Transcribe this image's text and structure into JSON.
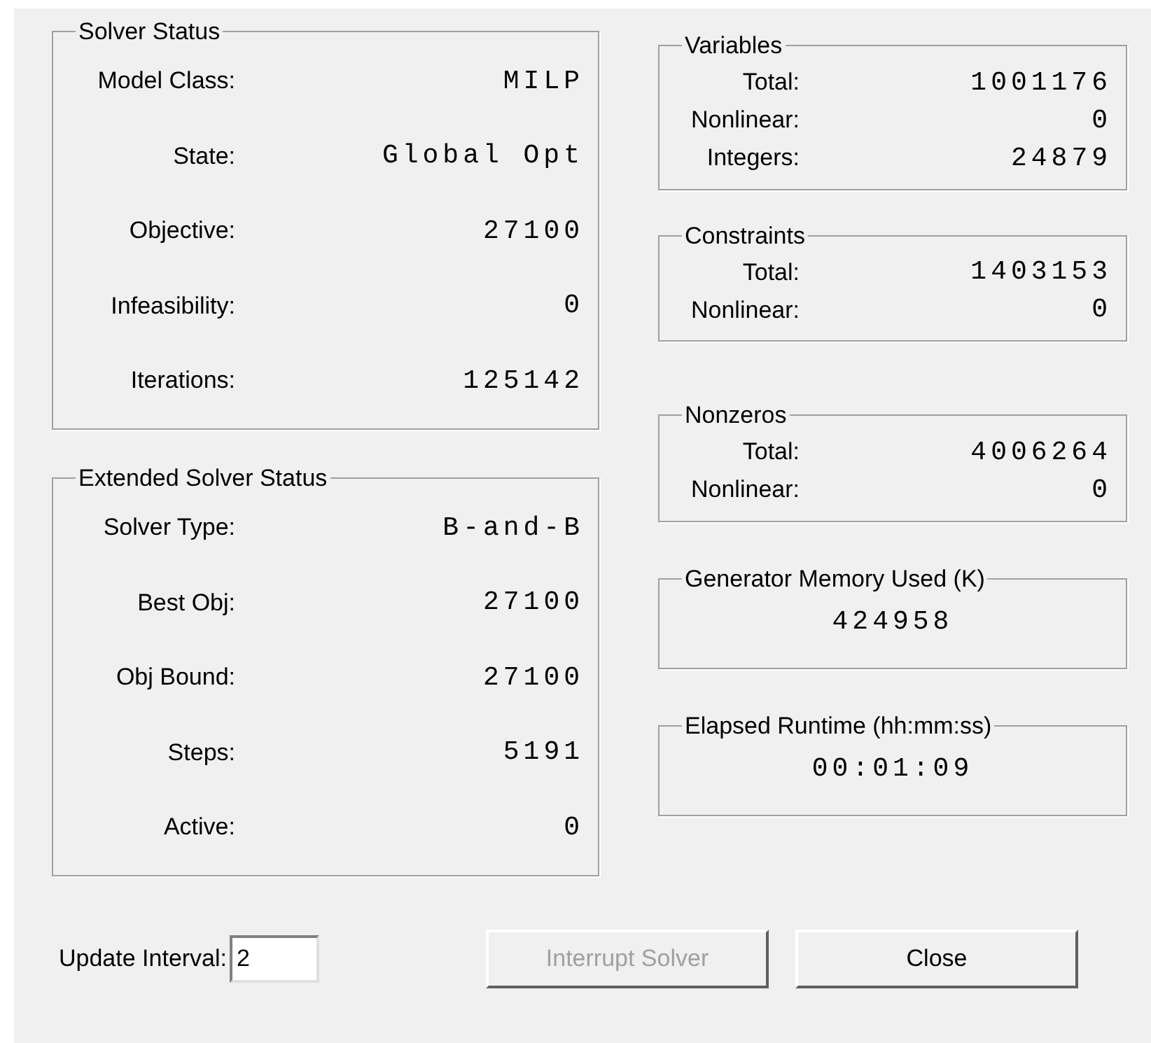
{
  "left_groups": [
    {
      "title": "Solver Status",
      "rows": [
        {
          "label": "Model Class:",
          "value": "MILP"
        },
        {
          "label": "State:",
          "value": "Global Opt"
        },
        {
          "label": "Objective:",
          "value": "27100"
        },
        {
          "label": "Infeasibility:",
          "value": "0"
        },
        {
          "label": "Iterations:",
          "value": "125142"
        }
      ]
    },
    {
      "title": "Extended Solver Status",
      "rows": [
        {
          "label": "Solver Type:",
          "value": "B-and-B"
        },
        {
          "label": "Best Obj:",
          "value": "27100"
        },
        {
          "label": "Obj Bound:",
          "value": "27100"
        },
        {
          "label": "Steps:",
          "value": "5191"
        },
        {
          "label": "Active:",
          "value": "0"
        }
      ]
    }
  ],
  "right_groups": [
    {
      "title": "Variables",
      "kind": "table",
      "rows": [
        {
          "label": "Total:",
          "value": "1001176"
        },
        {
          "label": "Nonlinear:",
          "value": "0"
        },
        {
          "label": "Integers:",
          "value": "24879"
        }
      ]
    },
    {
      "title": "Constraints",
      "kind": "table",
      "rows": [
        {
          "label": "Total:",
          "value": "1403153"
        },
        {
          "label": "Nonlinear:",
          "value": "0"
        }
      ]
    },
    {
      "title": "Nonzeros",
      "kind": "table",
      "rows": [
        {
          "label": "Total:",
          "value": "4006264"
        },
        {
          "label": "Nonlinear:",
          "value": "0"
        }
      ]
    },
    {
      "title": "Generator Memory Used (K)",
      "kind": "single",
      "value": "424958"
    },
    {
      "title": "Elapsed Runtime (hh:mm:ss)",
      "kind": "single",
      "value": "00:01:09"
    }
  ],
  "update_interval": {
    "label": "Update Interval:",
    "value": "2"
  },
  "buttons": [
    {
      "label": "Interrupt Solver",
      "disabled": true
    },
    {
      "label": "Close",
      "disabled": false
    }
  ]
}
